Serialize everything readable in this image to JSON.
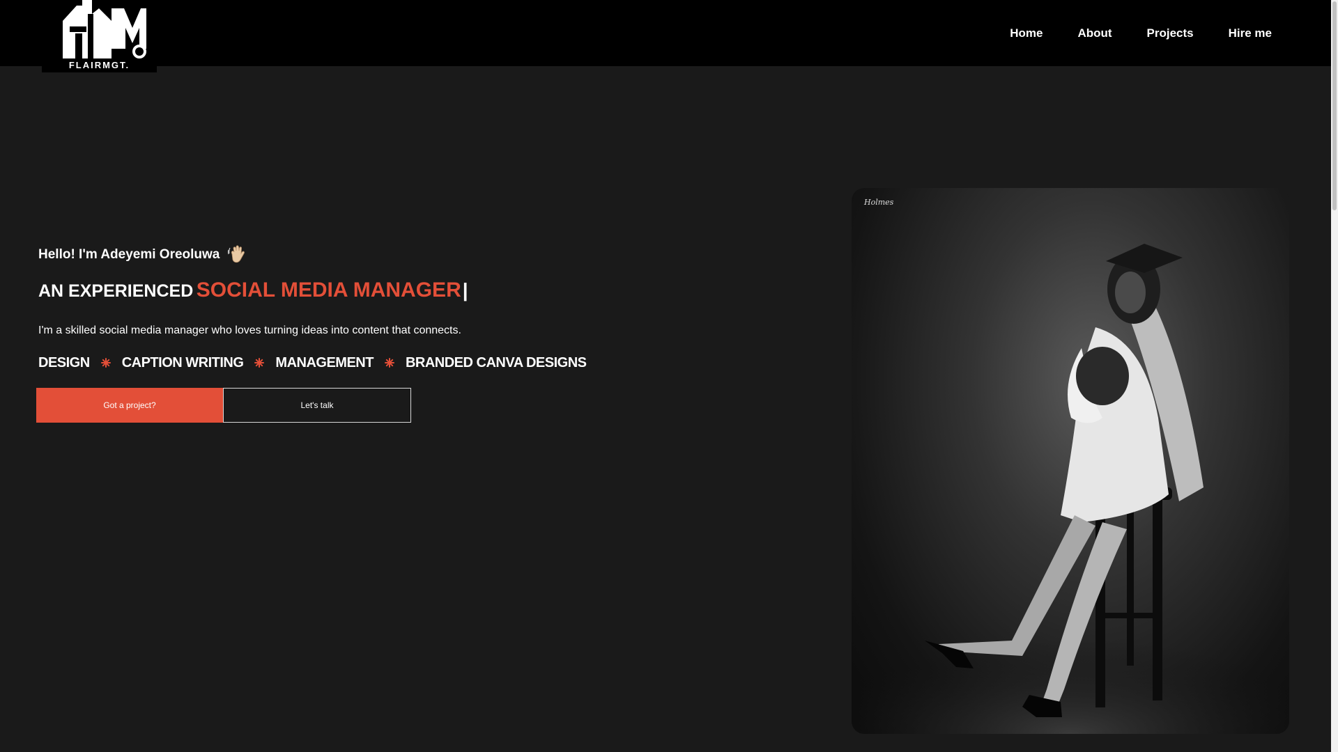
{
  "header": {
    "logo_text": "FLAIRMGT.",
    "nav": [
      {
        "label": "Home"
      },
      {
        "label": "About"
      },
      {
        "label": "Projects"
      },
      {
        "label": "Hire me"
      }
    ]
  },
  "hero": {
    "greeting": "Hello! I'm Adeyemi Oreoluwa",
    "headline_prefix": "AN EXPERIENCED",
    "headline_accent": "SOCIAL MEDIA MANAGER",
    "headline_cursor": "|",
    "intro": "I'm a skilled social media manager who loves turning ideas into content that connects.",
    "skills": [
      "DESIGN",
      "CAPTION WRITING",
      "MANAGEMENT",
      "BRANDED CANVA DESIGNS"
    ],
    "primary_button": "Got a project?",
    "secondary_button": "Let's talk"
  },
  "photo": {
    "signature": "Holmes"
  },
  "colors": {
    "accent": "#e34f38",
    "background": "#1a1a1a",
    "header": "#000000"
  },
  "icons": {
    "greeting": "waving-hand-icon",
    "skill_separator": "asterisk-star-icon"
  }
}
